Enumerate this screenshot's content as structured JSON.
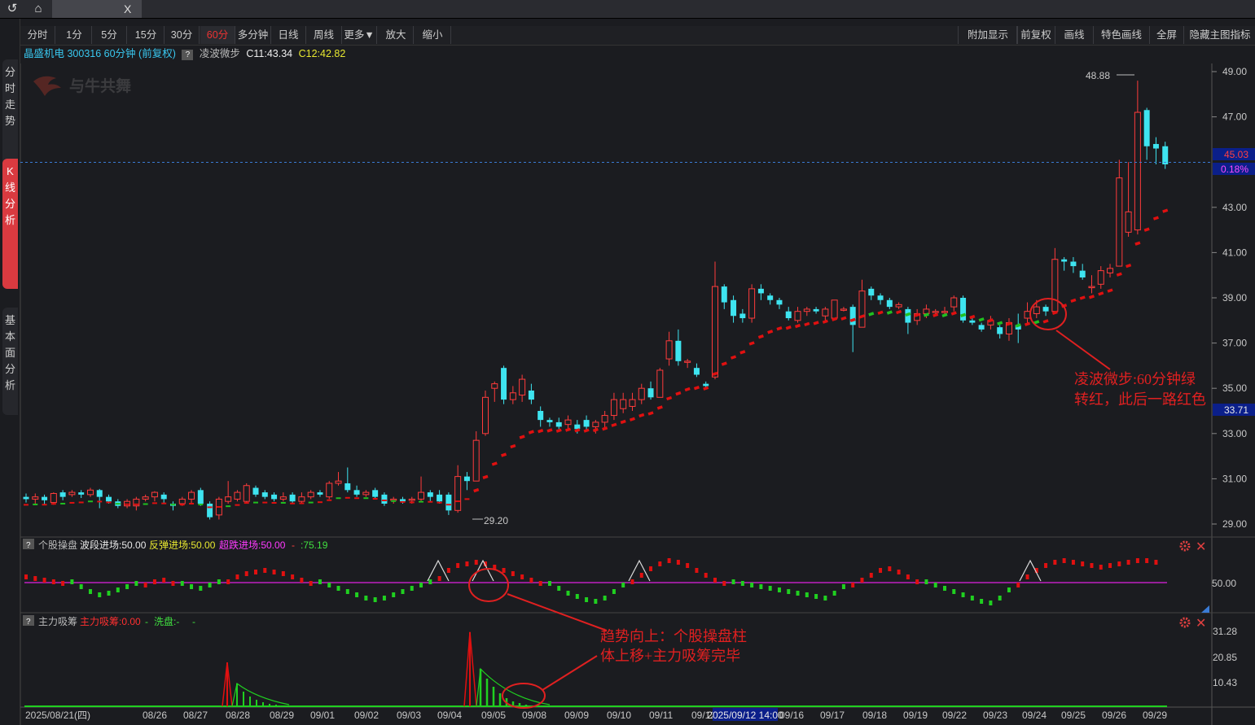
{
  "topbar": {
    "back_icon": "undo-icon",
    "home_icon": "home-icon",
    "tab_label": "",
    "tab_close": "X"
  },
  "sidebar": {
    "tabs": [
      "分时走势",
      "K线分析",
      "基本面分析"
    ]
  },
  "toolbar": {
    "periods": [
      "分时",
      "1分",
      "5分",
      "15分",
      "30分",
      "60分",
      "多分钟",
      "日线",
      "周线",
      "更多▼",
      "放大",
      "缩小"
    ],
    "selected": "60分",
    "right_buttons": [
      "附加显示",
      "前复权",
      "画线",
      "特色画线",
      "全屏",
      "隐藏主图指标"
    ]
  },
  "info": {
    "stock": "晶盛机电 300316 60分钟 (前复权)",
    "indicator": "凌波微步",
    "c11": "C11:43.34",
    "c12": "C12:42.82"
  },
  "watermark": "与牛共舞",
  "main_chart": {
    "y_ticks": [
      "49.00",
      "47.00",
      "45.03",
      "0.18%",
      "43.00",
      "41.00",
      "39.00",
      "37.00",
      "35.00",
      "33.71",
      "33.00",
      "31.00",
      "29.00"
    ],
    "high_label": "48.88",
    "low_label": "29.20",
    "price_tag": "45.03",
    "pct_tag": "0.18%",
    "cursor_tag": "33.71",
    "annotation": [
      "凌波微步:60分钟绿",
      "转红，此后一路红色"
    ]
  },
  "panel2": {
    "title": "个股操盘",
    "a": "波段进场:50.00",
    "b": "反弹进场:50.00",
    "c": "超跌进场:50.00",
    "d": ":75.19",
    "y_tick": "50.00",
    "annotation": [
      "趋势向上：个股操盘柱",
      "体上移+主力吸筹完毕"
    ]
  },
  "panel3": {
    "title": "主力吸筹",
    "a": "主力吸筹:0.00",
    "b": "洗盘:-",
    "y_ticks": [
      "31.28",
      "20.85",
      "10.43"
    ]
  },
  "x_axis": {
    "labels": [
      "2025/08/21(四)",
      "08/26",
      "08/27",
      "08/28",
      "08/29",
      "09/01",
      "09/02",
      "09/03",
      "09/04",
      "09/05",
      "09/08",
      "09/09",
      "09/10",
      "09/11",
      "09/12",
      "09/16",
      "09/17",
      "09/18",
      "09/19",
      "09/22",
      "09/23",
      "09/24",
      "09/25",
      "09/26",
      "09/29"
    ],
    "cursor_label": "2025/09/12 14:00"
  },
  "chart_data": {
    "type": "candlestick",
    "period": "60分钟",
    "y_range": [
      28.5,
      49.5
    ],
    "candles": [
      [
        30.2,
        30.1,
        30.35,
        29.95
      ],
      [
        30.1,
        30.2,
        30.35,
        29.9
      ],
      [
        30.2,
        30.05,
        30.3,
        29.85
      ],
      [
        29.95,
        30.35,
        30.4,
        29.85
      ],
      [
        30.4,
        30.2,
        30.5,
        30.05
      ],
      [
        30.3,
        30.4,
        30.5,
        30.2
      ],
      [
        30.4,
        30.3,
        30.5,
        30.15
      ],
      [
        30.3,
        30.5,
        30.6,
        30.2
      ],
      [
        30.5,
        30.2,
        30.55,
        29.7
      ],
      [
        30.2,
        30.0,
        30.3,
        29.9
      ],
      [
        30.0,
        29.8,
        30.1,
        29.7
      ],
      [
        29.8,
        30.0,
        30.1,
        29.7
      ],
      [
        29.8,
        30.1,
        30.2,
        29.6
      ],
      [
        30.1,
        30.2,
        30.3,
        30.0
      ],
      [
        30.2,
        30.4,
        30.45,
        30.0
      ],
      [
        30.3,
        30.1,
        30.4,
        29.9
      ],
      [
        29.9,
        29.8,
        30.0,
        29.6
      ],
      [
        29.9,
        30.1,
        30.2,
        29.8
      ],
      [
        30.1,
        30.4,
        30.5,
        29.9
      ],
      [
        30.5,
        29.9,
        30.6,
        29.8
      ],
      [
        29.9,
        29.3,
        30.0,
        29.2
      ],
      [
        29.4,
        30.1,
        30.2,
        29.2
      ],
      [
        30.0,
        30.2,
        30.9,
        29.9
      ],
      [
        30.1,
        30.4,
        30.5,
        30.0
      ],
      [
        30.0,
        30.7,
        30.8,
        29.9
      ],
      [
        30.6,
        30.3,
        30.7,
        30.2
      ],
      [
        30.4,
        30.2,
        30.5,
        30.1
      ],
      [
        30.3,
        30.1,
        30.4,
        30.0
      ],
      [
        30.1,
        30.2,
        30.4,
        30.0
      ],
      [
        30.3,
        30.0,
        30.4,
        29.9
      ],
      [
        30.0,
        30.2,
        30.4,
        29.9
      ],
      [
        30.2,
        30.4,
        30.5,
        30.1
      ],
      [
        30.4,
        30.3,
        30.5,
        30.2
      ],
      [
        30.2,
        30.8,
        30.9,
        30.1
      ],
      [
        30.8,
        30.9,
        31.3,
        30.7
      ],
      [
        30.8,
        30.5,
        31.5,
        30.4
      ],
      [
        30.5,
        30.3,
        30.7,
        30.2
      ],
      [
        30.3,
        30.4,
        30.5,
        30.2
      ],
      [
        30.5,
        30.2,
        30.6,
        30.1
      ],
      [
        30.3,
        29.9,
        30.4,
        29.8
      ],
      [
        30.1,
        30.1,
        30.2,
        29.9
      ],
      [
        30.1,
        30.0,
        30.2,
        29.9
      ],
      [
        30.1,
        30.1,
        30.2,
        29.9
      ],
      [
        30.1,
        30.4,
        31.1,
        30.0
      ],
      [
        30.4,
        30.2,
        30.5,
        30.0
      ],
      [
        30.3,
        30.0,
        30.5,
        29.9
      ],
      [
        30.3,
        29.6,
        30.4,
        29.4
      ],
      [
        29.6,
        31.1,
        31.6,
        29.5
      ],
      [
        31.1,
        30.9,
        31.3,
        30.5
      ],
      [
        30.9,
        32.7,
        33.1,
        30.9
      ],
      [
        33.0,
        34.6,
        34.9,
        32.9
      ],
      [
        35.0,
        35.2,
        35.3,
        34.4
      ],
      [
        35.9,
        34.5,
        36.0,
        34.3
      ],
      [
        34.5,
        34.8,
        35.1,
        34.3
      ],
      [
        34.7,
        35.4,
        35.6,
        34.4
      ],
      [
        34.9,
        34.5,
        35.2,
        34.3
      ],
      [
        34.0,
        33.6,
        34.2,
        33.3
      ],
      [
        33.6,
        33.5,
        33.7,
        33.3
      ],
      [
        33.5,
        33.3,
        33.7,
        33.2
      ],
      [
        33.4,
        33.6,
        33.8,
        33.2
      ],
      [
        33.4,
        33.2,
        33.6,
        33.0
      ],
      [
        33.6,
        33.3,
        33.8,
        33.1
      ],
      [
        33.3,
        33.5,
        33.6,
        33.0
      ],
      [
        33.5,
        33.8,
        34.0,
        33.2
      ],
      [
        33.8,
        34.5,
        34.8,
        33.6
      ],
      [
        34.1,
        34.5,
        34.8,
        33.9
      ],
      [
        34.2,
        34.5,
        34.8,
        34.0
      ],
      [
        34.5,
        35.0,
        35.2,
        34.3
      ],
      [
        35.0,
        34.6,
        35.3,
        34.5
      ],
      [
        34.6,
        35.8,
        35.9,
        34.6
      ],
      [
        36.3,
        37.1,
        37.5,
        36.0
      ],
      [
        37.1,
        36.2,
        37.6,
        36.0
      ],
      [
        36.2,
        36.2,
        36.3,
        35.9
      ],
      [
        35.9,
        35.6,
        36.1,
        35.5
      ],
      [
        35.2,
        35.1,
        35.3,
        35.0
      ],
      [
        35.5,
        39.5,
        40.6,
        35.4
      ],
      [
        39.5,
        38.8,
        39.6,
        38.5
      ],
      [
        38.9,
        38.2,
        39.1,
        37.9
      ],
      [
        38.3,
        38.1,
        38.5,
        37.9
      ],
      [
        38.1,
        39.4,
        39.6,
        37.9
      ],
      [
        39.4,
        39.2,
        39.6,
        38.9
      ],
      [
        39.1,
        38.9,
        39.2,
        38.7
      ],
      [
        38.9,
        38.7,
        39.0,
        38.5
      ],
      [
        38.4,
        38.1,
        38.6,
        38.0
      ],
      [
        38.0,
        38.4,
        38.6,
        37.9
      ],
      [
        38.4,
        38.5,
        38.6,
        38.2
      ],
      [
        38.5,
        38.4,
        38.6,
        38.3
      ],
      [
        38.2,
        38.5,
        38.6,
        38.0
      ],
      [
        38.1,
        38.9,
        38.9,
        38.0
      ],
      [
        38.5,
        38.5,
        38.6,
        38.4
      ],
      [
        38.6,
        37.8,
        38.7,
        36.6
      ],
      [
        37.7,
        39.3,
        39.8,
        37.7
      ],
      [
        39.4,
        39.1,
        39.5,
        38.9
      ],
      [
        39.1,
        38.9,
        39.2,
        38.7
      ],
      [
        38.9,
        38.6,
        39.0,
        38.5
      ],
      [
        38.6,
        38.7,
        38.8,
        38.5
      ],
      [
        38.5,
        37.9,
        38.6,
        37.4
      ],
      [
        38.0,
        38.3,
        38.5,
        37.8
      ],
      [
        38.3,
        38.5,
        38.7,
        38.1
      ],
      [
        38.4,
        38.4,
        38.5,
        38.2
      ],
      [
        38.4,
        38.4,
        38.6,
        38.2
      ],
      [
        38.6,
        39.0,
        39.1,
        38.4
      ],
      [
        39.0,
        38.0,
        39.1,
        37.9
      ],
      [
        38.0,
        37.9,
        38.1,
        37.8
      ],
      [
        37.8,
        37.6,
        37.9,
        37.5
      ],
      [
        37.8,
        38.0,
        38.2,
        37.6
      ],
      [
        37.7,
        37.4,
        37.8,
        37.2
      ],
      [
        37.4,
        37.9,
        38.1,
        37.1
      ],
      [
        37.8,
        37.6,
        38.3,
        37.0
      ],
      [
        38.1,
        38.4,
        38.8,
        37.9
      ],
      [
        38.3,
        38.6,
        38.9,
        38.1
      ],
      [
        38.6,
        38.4,
        38.7,
        38.2
      ],
      [
        38.4,
        40.7,
        41.2,
        38.3
      ],
      [
        40.7,
        40.6,
        40.8,
        40.2
      ],
      [
        40.6,
        40.4,
        40.8,
        40.1
      ],
      [
        40.2,
        39.9,
        40.5,
        39.8
      ],
      [
        39.5,
        39.5,
        40.0,
        39.2
      ],
      [
        39.6,
        40.2,
        40.4,
        39.4
      ],
      [
        40.1,
        40.3,
        40.5,
        39.9
      ],
      [
        40.4,
        44.3,
        45.1,
        40.4
      ],
      [
        41.9,
        42.8,
        45.0,
        41.7
      ],
      [
        42.0,
        47.2,
        48.6,
        41.8
      ],
      [
        47.3,
        45.7,
        47.4,
        45.1
      ],
      [
        45.8,
        45.6,
        46.1,
        44.9
      ],
      [
        45.7,
        44.9,
        45.9,
        44.7
      ]
    ],
    "lingbo_weibu": {
      "red_from_index": 111
    },
    "panel2_columns": "波段进场 / 反弹进场 / 超跌进场 histogram around 50.00",
    "panel3_peaks": [
      20.0,
      31.0,
      10.4
    ]
  }
}
